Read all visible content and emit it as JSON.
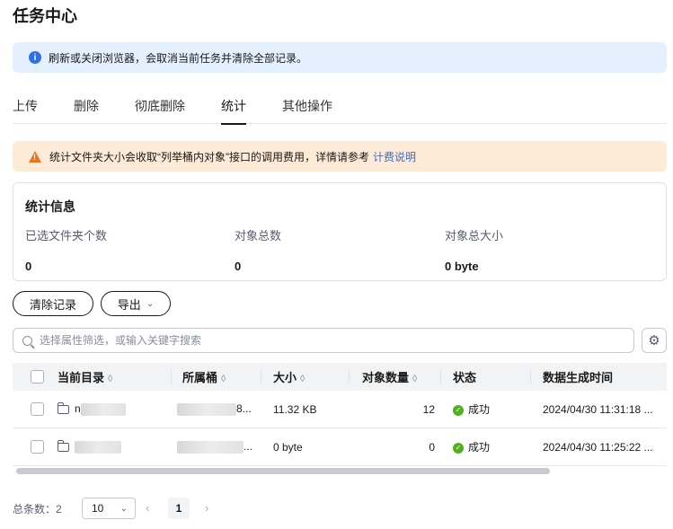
{
  "page": {
    "title": "任务中心"
  },
  "info_notice": {
    "icon": "info-icon",
    "text": "刷新或关闭浏览器，会取消当前任务并清除全部记录。"
  },
  "tabs": [
    {
      "label": "上传",
      "active": false
    },
    {
      "label": "删除",
      "active": false
    },
    {
      "label": "彻底删除",
      "active": false
    },
    {
      "label": "统计",
      "active": true
    },
    {
      "label": "其他操作",
      "active": false
    }
  ],
  "warning_notice": {
    "icon": "warning-icon",
    "text": "统计文件夹大小会收取“列举桶内对象”接口的调用费用，详情请参考",
    "link": "计费说明"
  },
  "stats": {
    "title": "统计信息",
    "items": [
      {
        "label": "已选文件夹个数",
        "value": "0"
      },
      {
        "label": "对象总数",
        "value": "0"
      },
      {
        "label": "对象总大小",
        "value": "0 byte"
      }
    ]
  },
  "toolbar": {
    "clear_label": "清除记录",
    "export_label": "导出"
  },
  "search": {
    "placeholder": "选择属性筛选，或输入关键字搜索",
    "value": ""
  },
  "table": {
    "columns": [
      "当前目录",
      "所属桶",
      "大小",
      "对象数量",
      "状态",
      "数据生成时间"
    ],
    "rows": [
      {
        "dir_visible": "n",
        "bucket_visible": "8...",
        "size": "11.32 KB",
        "count": "12",
        "status": "成功",
        "time": "2024/04/30 11:31:18 ..."
      },
      {
        "dir_visible": "",
        "bucket_visible": "...",
        "size": "0 byte",
        "count": "0",
        "status": "成功",
        "time": "2024/04/30 11:25:22 ..."
      }
    ]
  },
  "pagination": {
    "total_label": "总条数：2",
    "page_size": "10",
    "current_page": "1"
  },
  "colors": {
    "primary": "#2e6ee6",
    "info_bg": "#e5f0fe",
    "warn_bg": "#fdebd8",
    "warn_icon": "#e8741e",
    "success": "#50b020"
  }
}
